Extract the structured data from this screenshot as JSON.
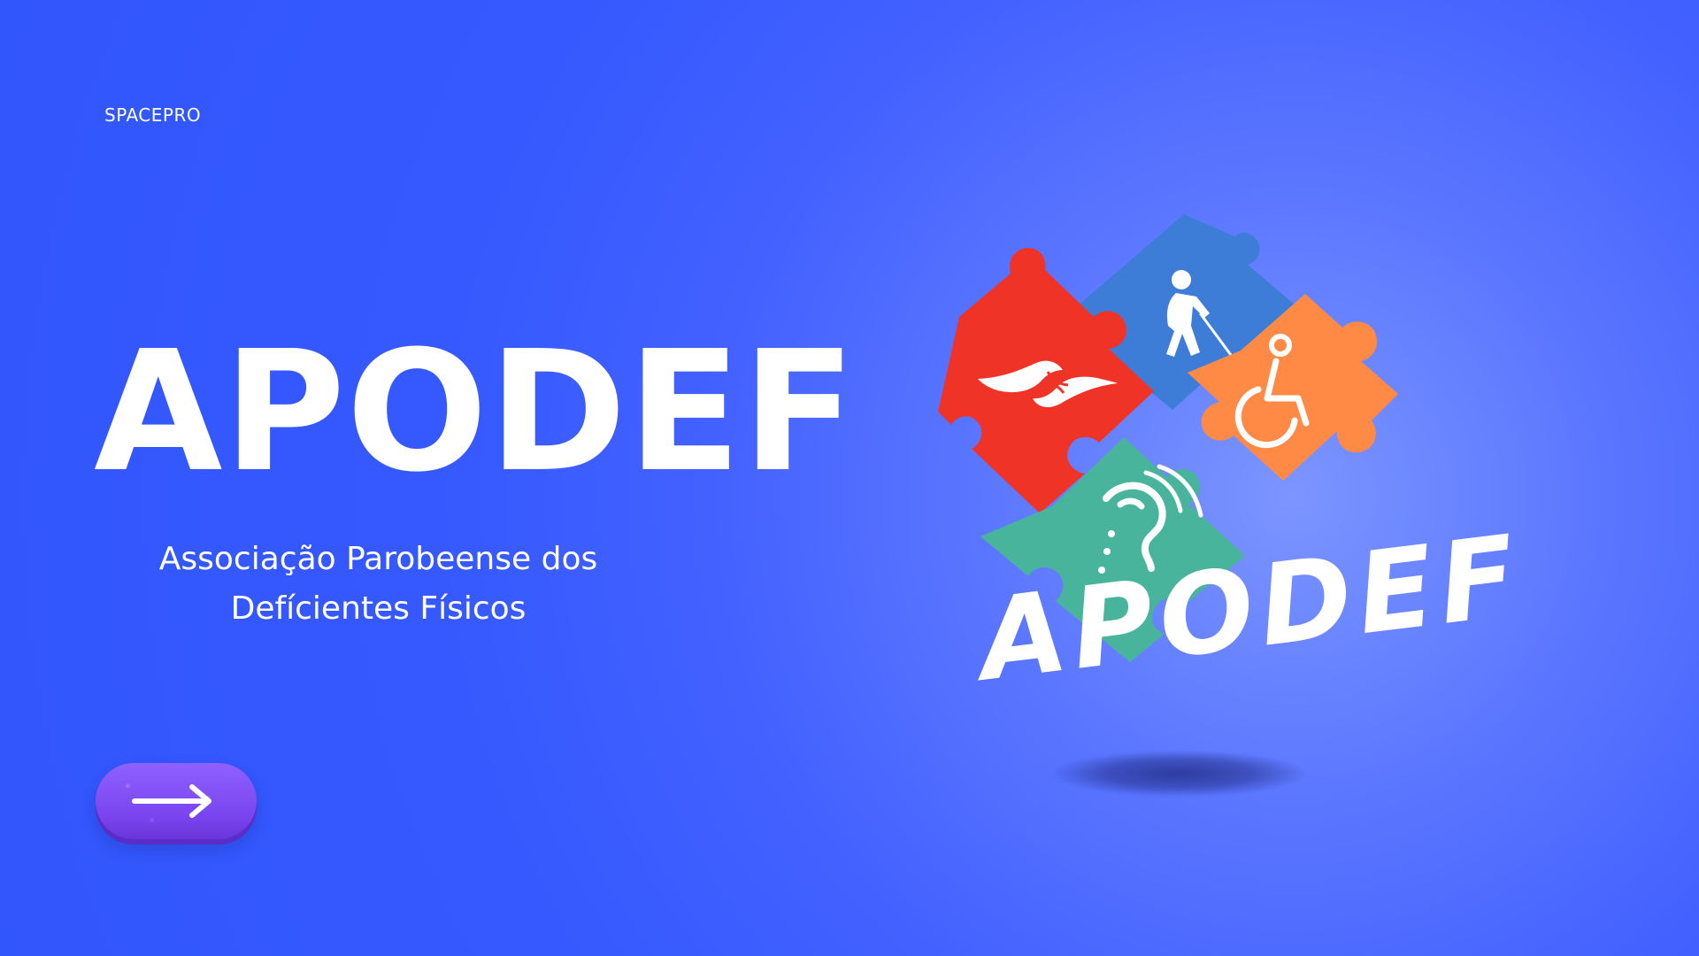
{
  "brand": {
    "name": "SPACEPRO"
  },
  "hero": {
    "title": "APODEF",
    "subtitle_line_1": "Associação Parobeense dos",
    "subtitle_line_2": "Defícientes Físicos"
  },
  "cta": {
    "icon": "arrow-right-icon"
  },
  "logo": {
    "wordmark": "APODEF",
    "pieces": [
      {
        "name": "sign-language-hands-icon",
        "color": "#ef3427"
      },
      {
        "name": "blind-person-with-cane-icon",
        "color": "#3d7dd7"
      },
      {
        "name": "wheelchair-accessibility-icon",
        "color": "#ff8a45"
      },
      {
        "name": "hearing-assistance-icon",
        "color": "#49b49c"
      }
    ]
  },
  "colors": {
    "background": "#3559ff",
    "button": "#7a44ef",
    "text": "#ffffff"
  }
}
